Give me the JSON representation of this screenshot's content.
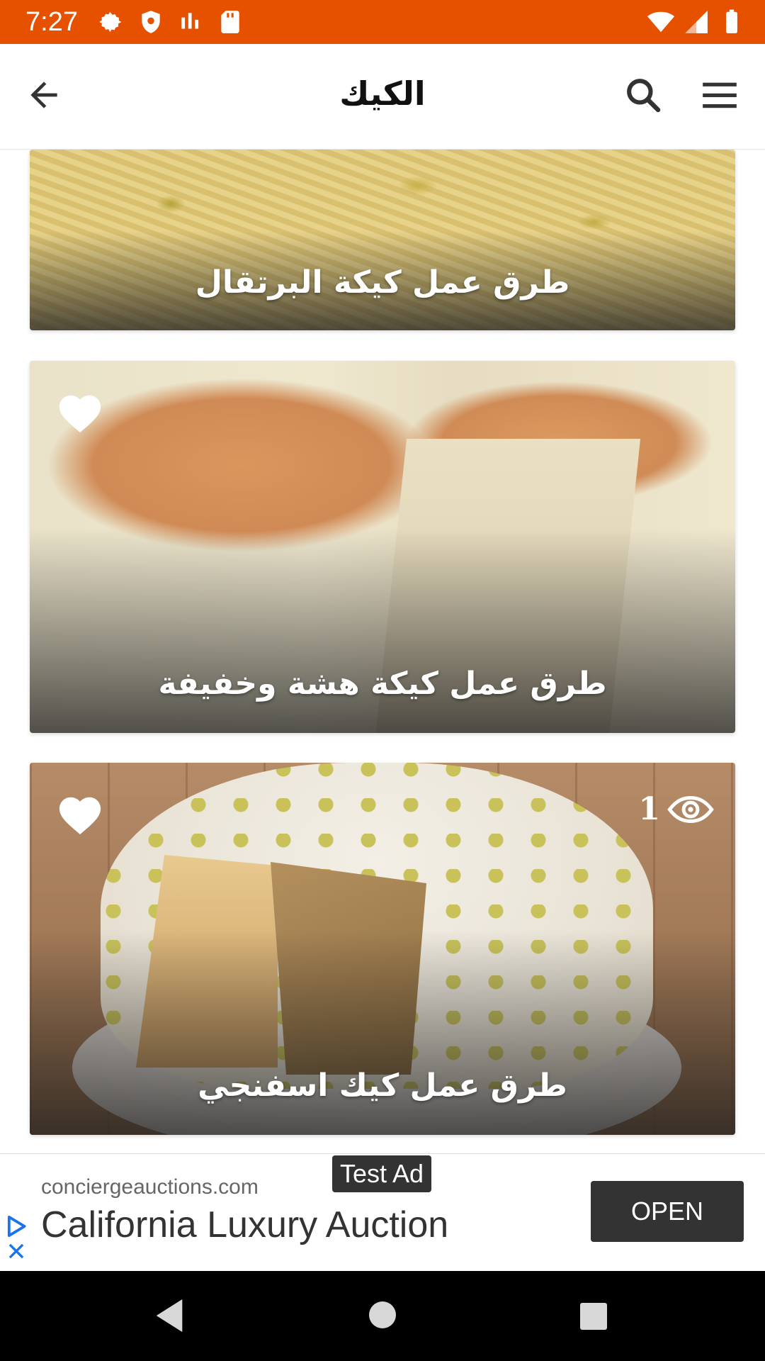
{
  "status_bar": {
    "time": "7:27",
    "color": "#e65100",
    "left_icons": [
      "settings-icon",
      "shield-icon",
      "signal-bars-icon",
      "sd-card-icon"
    ],
    "right_icons": [
      "wifi-icon",
      "cell-signal-icon",
      "battery-icon"
    ]
  },
  "app_bar": {
    "title": "الكيك",
    "back_icon": "arrow-left-icon",
    "search_icon": "search-icon",
    "menu_icon": "hamburger-menu-icon"
  },
  "cards": [
    {
      "title": "طرق عمل كيكة البرتقال"
    },
    {
      "title": "طرق عمل كيكة هشة وخفيفة",
      "favorite_icon": "heart-icon"
    },
    {
      "title": "طرق عمل كيك اسفنجي",
      "favorite_icon": "heart-icon",
      "views": "1",
      "views_icon": "eye-icon"
    }
  ],
  "ad": {
    "badge": "Test Ad",
    "domain": "conciergeauctions.com",
    "title": "California Luxury Auction",
    "cta": "OPEN"
  },
  "nav_bar": {
    "buttons": [
      "back-triangle-icon",
      "home-circle-icon",
      "recents-square-icon"
    ]
  }
}
